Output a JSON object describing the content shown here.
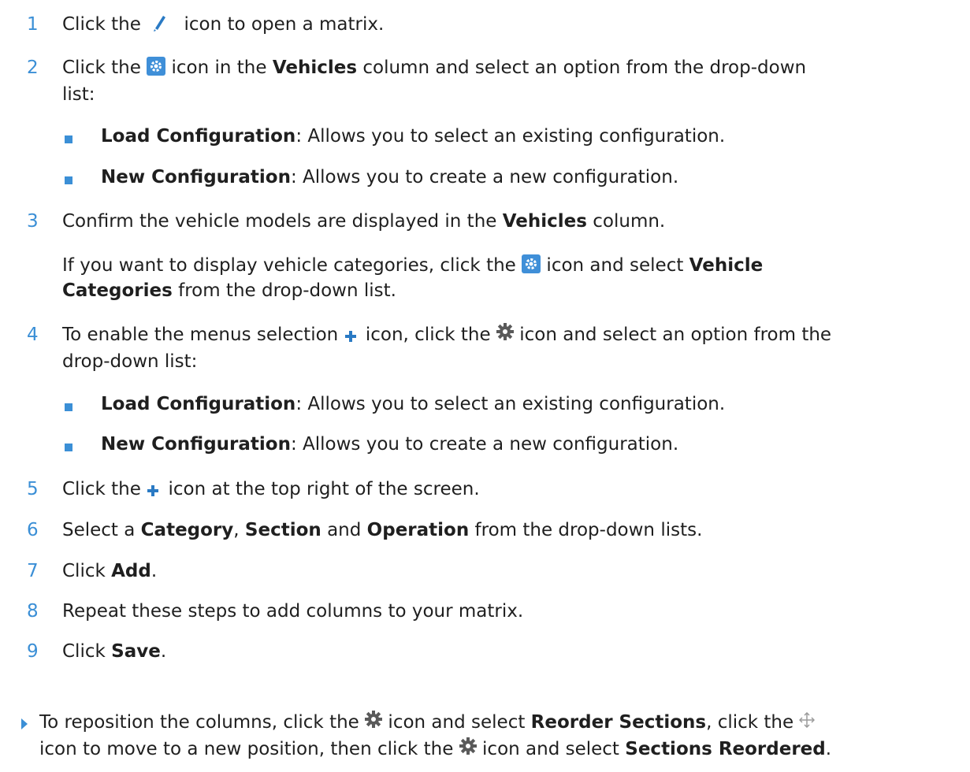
{
  "colors": {
    "accent": "#3b8fd6",
    "text": "#1f1f1f"
  },
  "icons": {
    "pencil": "pencil-icon",
    "settings_blue": "settings-square-icon",
    "gear": "gear-icon",
    "plus": "plus-icon",
    "move": "move-icon"
  },
  "steps": [
    {
      "num": "1",
      "a": "Click the ",
      "b": " icon to open a matrix."
    },
    {
      "num": "2",
      "a": "Click the ",
      "b": " icon in the ",
      "bold1": "Vehicles",
      "c": " column and select an option from the drop-down",
      "line2": "list:"
    },
    {
      "num": "3",
      "a": "Confirm the vehicle models are displayed in the ",
      "bold1": "Vehicles",
      "c": " column."
    },
    {
      "num": "4",
      "a": "To enable the menus selection ",
      "b": " icon, click the ",
      "c": " icon and select an option from the",
      "line2": "drop-down list:"
    },
    {
      "num": "5",
      "a": "Click the ",
      "b": " icon at the top right of the screen."
    },
    {
      "num": "6",
      "a": "Select a ",
      "bold1": "Category",
      "sep1": ", ",
      "bold2": "Section",
      "sep2": " and ",
      "bold3": "Operation",
      "c": " from the drop-down lists."
    },
    {
      "num": "7",
      "a": "Click ",
      "bold1": "Add",
      "c": "."
    },
    {
      "num": "8",
      "a": "Repeat these steps to add columns to your matrix."
    },
    {
      "num": "9",
      "a": "Click ",
      "bold1": "Save",
      "c": "."
    }
  ],
  "options_block_1": [
    {
      "bold": "Load Configuration",
      "text": ": Allows you to select an existing configuration."
    },
    {
      "bold": "New Configuration",
      "text": ": Allows you to create a new configuration."
    }
  ],
  "step3_note": {
    "a": "If you want to display vehicle categories, click the ",
    "b": " icon and select ",
    "bold1": "Vehicle",
    "line2_bold": "Categories",
    "line2_rest": " from the drop-down list."
  },
  "options_block_2": [
    {
      "bold": "Load Configuration",
      "text": ": Allows you to select an existing configuration."
    },
    {
      "bold": "New Configuration",
      "text": ": Allows you to create a new configuration."
    }
  ],
  "tip": {
    "a": "To reposition the columns, click the ",
    "b": " icon and select ",
    "bold1": "Reorder Sections",
    "c": ", click the ",
    "line2_a": "icon to move to a new position, then click the ",
    "line2_b": " icon and select ",
    "line2_bold": "Sections Reordered",
    "line2_end": "."
  }
}
